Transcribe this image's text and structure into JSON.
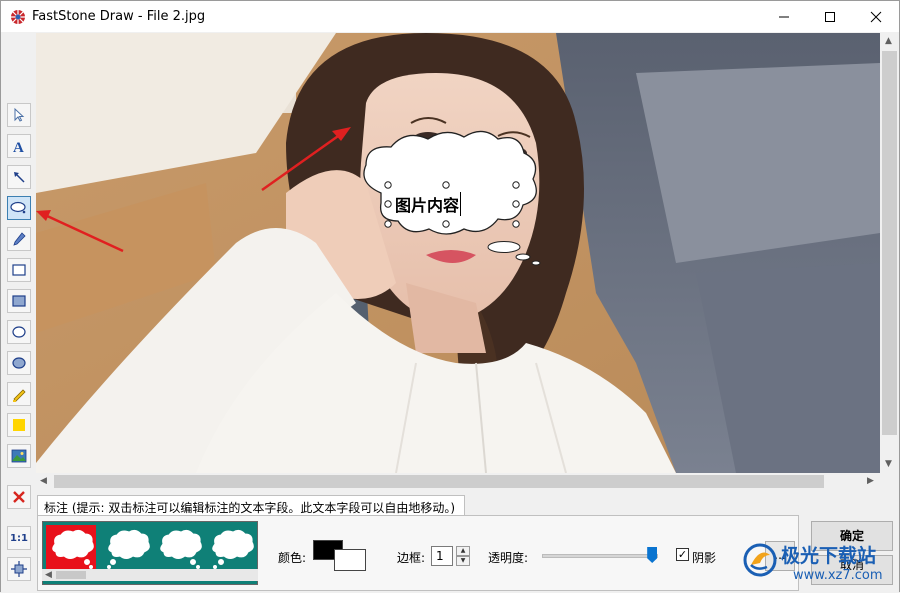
{
  "window": {
    "title": "FastStone Draw - File 2.jpg"
  },
  "toolbar": {
    "tools": [
      {
        "name": "select-tool",
        "icon": "pointer-icon"
      },
      {
        "name": "text-tool",
        "icon": "text-a-icon"
      },
      {
        "name": "arrow-tool",
        "icon": "arrow-line-icon"
      },
      {
        "name": "callout-tool",
        "icon": "ellipse-callout-icon",
        "active": true
      },
      {
        "name": "pen-tool",
        "icon": "pencil-icon"
      },
      {
        "name": "rectangle-tool",
        "icon": "rectangle-icon"
      },
      {
        "name": "filled-rectangle-tool",
        "icon": "filled-rectangle-icon"
      },
      {
        "name": "ellipse-tool",
        "icon": "ellipse-icon"
      },
      {
        "name": "filled-ellipse-tool",
        "icon": "filled-ellipse-icon"
      },
      {
        "name": "highlighter-tool",
        "icon": "highlighter-icon"
      },
      {
        "name": "fill-tool",
        "icon": "yellow-square-icon"
      },
      {
        "name": "image-tool",
        "icon": "picture-icon"
      },
      {
        "name": "delete-tool",
        "icon": "red-x-icon"
      },
      {
        "name": "actual-size-tool",
        "icon": "one-to-one-icon",
        "label": "1:1"
      },
      {
        "name": "fit-tool",
        "icon": "fit-window-icon"
      }
    ]
  },
  "canvas": {
    "callout_text": "图片内容"
  },
  "panel": {
    "tab_label": "标注 (提示: 双击标注可以编辑标注的文本字段。此文本字段可以自由地移动。)",
    "color_label": "颜色:",
    "border_label": "边框:",
    "border_value": "1",
    "opacity_label": "透明度:",
    "opacity_value": 0.95,
    "shadow_label": "阴影",
    "shadow_checked": true,
    "more_label": "...",
    "ok_label": "确定",
    "cancel_label": "取消",
    "colors": {
      "foreground": "#000000",
      "background": "#ffffff",
      "styles_bg": "#0f8077",
      "selected_style_bg": "#e8111b"
    }
  },
  "watermark": {
    "name": "极光下载站",
    "url": "www.xz7.com"
  }
}
